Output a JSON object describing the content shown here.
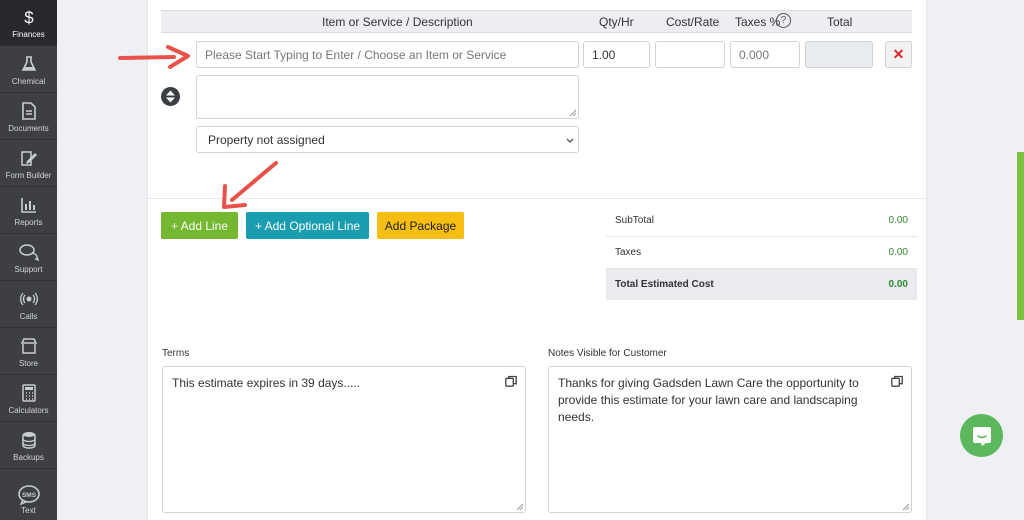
{
  "sidebar": {
    "items": [
      {
        "label": "Finances",
        "icon": "dollar-icon",
        "active": true
      },
      {
        "label": "Chemical",
        "icon": "flask-icon"
      },
      {
        "label": "Documents",
        "icon": "document-icon"
      },
      {
        "label": "Form Builder",
        "icon": "form-builder-icon"
      },
      {
        "label": "Reports",
        "icon": "bar-chart-icon"
      },
      {
        "label": "Support",
        "icon": "chat-bubbles-icon"
      },
      {
        "label": "Calls",
        "icon": "phone-icon"
      },
      {
        "label": "Store",
        "icon": "store-icon"
      },
      {
        "label": "Calculators",
        "icon": "calculator-icon"
      },
      {
        "label": "Backups",
        "icon": "database-icon"
      },
      {
        "label": "Text",
        "icon": "sms-icon"
      }
    ]
  },
  "table": {
    "headers": {
      "item": "Item or Service / Description",
      "qty": "Qty/Hr",
      "cost": "Cost/Rate",
      "taxes": "Taxes %",
      "total": "Total"
    }
  },
  "line": {
    "item_placeholder": "Please Start Typing to Enter / Choose an Item or Service",
    "qty": "1.00",
    "cost": "",
    "taxes_placeholder": "0.000",
    "total": "",
    "delete_label": "✕",
    "description": "",
    "property": "Property not assigned"
  },
  "actions": {
    "add_line": "+ Add Line",
    "add_optional_line": "+ Add Optional Line",
    "add_package": "Add Package"
  },
  "totals": {
    "subtotal_label": "SubTotal",
    "subtotal_value": "0.00",
    "taxes_label": "Taxes",
    "taxes_value": "0.00",
    "grand_label": "Total Estimated Cost",
    "grand_value": "0.00"
  },
  "terms": {
    "label": "Terms",
    "text": "This estimate expires in 39 days....."
  },
  "notes": {
    "label": "Notes Visible for Customer",
    "text": "Thanks for giving Gadsden Lawn Care the opportunity to provide this estimate for your lawn care and landscaping needs."
  },
  "colors": {
    "sidebar": "#3d3f43",
    "green": "#73b82f",
    "teal": "#1a9db1",
    "yellow": "#f6be12",
    "arrow": "#e8524a"
  }
}
